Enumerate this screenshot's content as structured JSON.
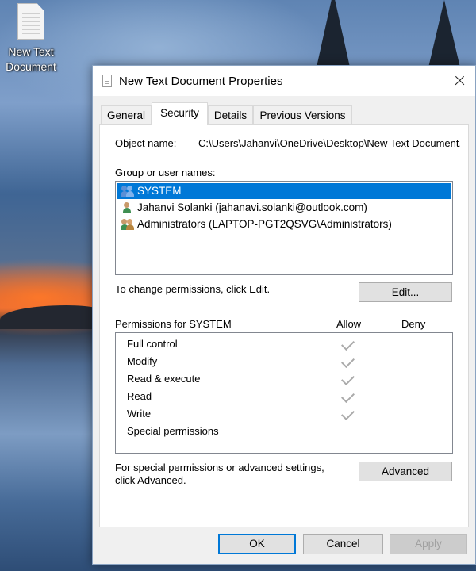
{
  "desktop": {
    "icon_label_line1": "New Text",
    "icon_label_line2": "Document"
  },
  "dialog": {
    "title": "New Text Document Properties",
    "tabs": [
      {
        "label": "General",
        "active": false
      },
      {
        "label": "Security",
        "active": true
      },
      {
        "label": "Details",
        "active": false
      },
      {
        "label": "Previous Versions",
        "active": false
      }
    ],
    "object_name_label": "Object name:",
    "object_name_value": "C:\\Users\\Jahanvi\\OneDrive\\Desktop\\New Text Document.txt",
    "group_label": "Group or user names:",
    "users": [
      {
        "name": "SYSTEM",
        "icon": "user-group-icon",
        "selected": true
      },
      {
        "name": "Jahanvi Solanki (jahanavi.solanki@outlook.com)",
        "icon": "user-icon",
        "selected": false
      },
      {
        "name": "Administrators (LAPTOP-PGT2QSVG\\Administrators)",
        "icon": "admin-group-icon",
        "selected": false
      }
    ],
    "change_permissions_text": "To change permissions, click Edit.",
    "edit_button": "Edit...",
    "permissions_label": "Permissions for SYSTEM",
    "allow_header": "Allow",
    "deny_header": "Deny",
    "permissions": [
      {
        "name": "Full control",
        "allow": true,
        "deny": false
      },
      {
        "name": "Modify",
        "allow": true,
        "deny": false
      },
      {
        "name": "Read & execute",
        "allow": true,
        "deny": false
      },
      {
        "name": "Read",
        "allow": true,
        "deny": false
      },
      {
        "name": "Write",
        "allow": true,
        "deny": false
      },
      {
        "name": "Special permissions",
        "allow": false,
        "deny": false
      }
    ],
    "special_text_line1": "For special permissions or advanced settings,",
    "special_text_line2": "click Advanced.",
    "advanced_button": "Advanced",
    "ok_button": "OK",
    "cancel_button": "Cancel",
    "apply_button": "Apply"
  },
  "colors": {
    "selection": "#0078d7",
    "check_gray": "#aaaaaa"
  }
}
